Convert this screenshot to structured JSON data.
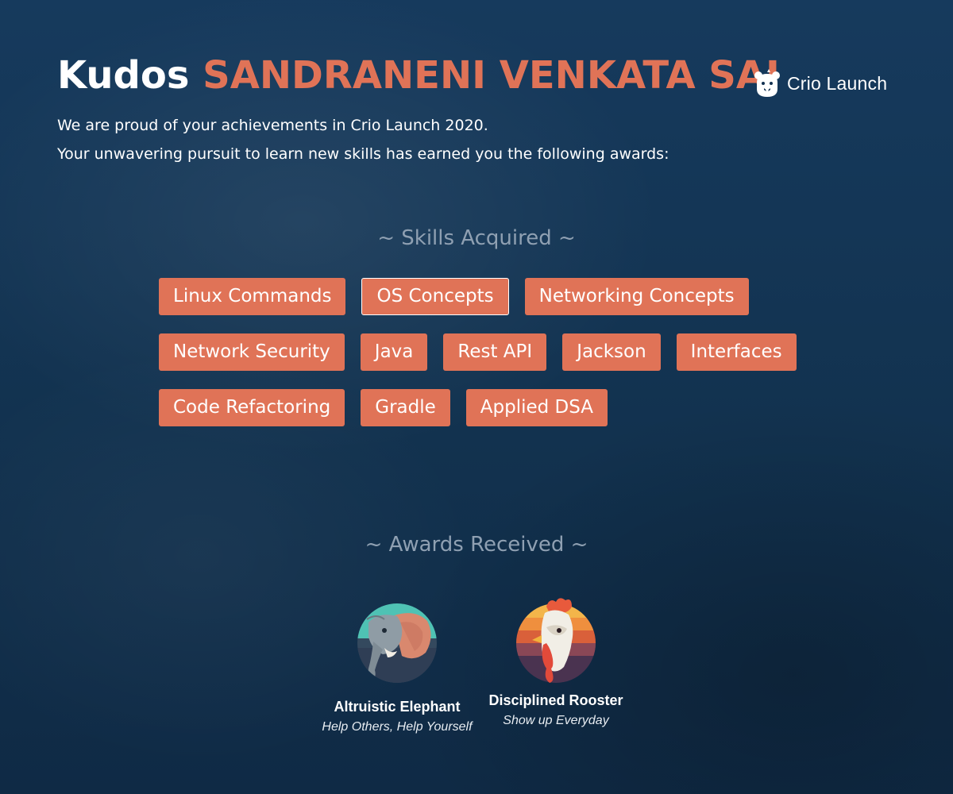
{
  "header": {
    "kudos": "Kudos",
    "name": "SANDRANENI VENKATA SAI"
  },
  "brand": {
    "name": "Crio Launch",
    "icon": "crio-bear-logo-icon"
  },
  "intro": {
    "line1": "We are proud of your achievements in Crio Launch 2020.",
    "line2": "Your unwavering pursuit to learn new skills has earned you the following awards:"
  },
  "skills": {
    "heading": "~ Skills Acquired ~",
    "rows": [
      [
        "Linux Commands",
        "OS Concepts",
        "Networking Concepts"
      ],
      [
        "Network Security",
        "Java",
        "Rest API",
        "Jackson",
        "Interfaces"
      ],
      [
        "Code Refactoring",
        "Gradle",
        "Applied DSA"
      ]
    ]
  },
  "awards": {
    "heading": "~ Awards Received ~",
    "items": [
      {
        "title": "Altruistic Elephant",
        "subtitle": "Help Others, Help Yourself",
        "icon": "elephant-badge-icon"
      },
      {
        "title": "Disciplined Rooster",
        "subtitle": "Show up Everyday",
        "icon": "rooster-badge-icon"
      }
    ]
  },
  "colors": {
    "background": "#123150",
    "accent": "#e07357",
    "heading_muted": "#8fa0b2",
    "text": "#ffffff"
  }
}
